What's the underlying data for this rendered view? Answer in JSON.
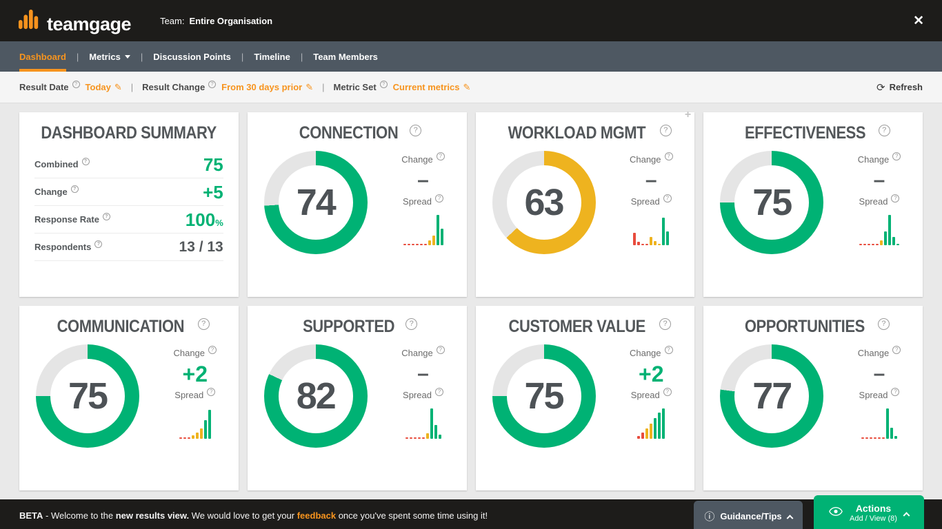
{
  "colors": {
    "orange": "#f7941e",
    "green": "#00b274",
    "yellow": "#eeb31f",
    "red": "#e84c3d",
    "gauge_track": "#e5e5e5"
  },
  "icons": {
    "question": "?",
    "edit": "✎",
    "refresh": "⟳",
    "divider": "|",
    "close": "✕",
    "info": "ⓘ",
    "move": "+"
  },
  "header": {
    "logo_text": "teamgage",
    "team_label": "Team:",
    "team_value": "Entire Organisation"
  },
  "nav": {
    "tabs": [
      {
        "label": "Dashboard",
        "active": true
      },
      {
        "label": "Metrics",
        "caret": true
      },
      {
        "label": "Discussion Points"
      },
      {
        "label": "Timeline"
      },
      {
        "label": "Team Members"
      }
    ]
  },
  "filters": {
    "result_date_label": "Result Date",
    "result_date_value": "Today",
    "result_change_label": "Result Change",
    "result_change_value": "From 30 days prior",
    "metric_set_label": "Metric Set",
    "metric_set_value": "Current metrics",
    "refresh_label": "Refresh"
  },
  "labels": {
    "change": "Change",
    "spread": "Spread"
  },
  "summary": {
    "title": "DASHBOARD SUMMARY",
    "rows": [
      {
        "label": "Combined",
        "value": "75",
        "tone": "green",
        "size": "lg"
      },
      {
        "label": "Change",
        "value": "+5",
        "tone": "green",
        "size": "lg"
      },
      {
        "label": "Response Rate",
        "value": "100",
        "suffix": "%",
        "tone": "green",
        "size": "lg"
      },
      {
        "label": "Respondents",
        "value": "13 / 13",
        "tone": "dark",
        "size": "md"
      }
    ]
  },
  "metrics": [
    {
      "title": "CONNECTION",
      "value": 74,
      "color": "green",
      "change": "–",
      "spread": [
        [
          2,
          "r"
        ],
        [
          2,
          "r"
        ],
        [
          2,
          "r"
        ],
        [
          2,
          "r"
        ],
        [
          2,
          "r"
        ],
        [
          2,
          "r"
        ],
        [
          7,
          "y"
        ],
        [
          14,
          "y"
        ],
        [
          44,
          "g"
        ],
        [
          24,
          "g"
        ]
      ]
    },
    {
      "title": "WORKLOAD MGMT",
      "value": 63,
      "color": "yellow",
      "change": "–",
      "move_handle": true,
      "spread": [
        [
          18,
          "r"
        ],
        [
          5,
          "r"
        ],
        [
          2,
          "r"
        ],
        [
          2,
          "r"
        ],
        [
          12,
          "y"
        ],
        [
          6,
          "y"
        ],
        [
          2,
          "y"
        ],
        [
          40,
          "g"
        ],
        [
          20,
          "g"
        ]
      ]
    },
    {
      "title": "EFFECTIVENESS",
      "value": 75,
      "color": "green",
      "change": "–",
      "spread": [
        [
          2,
          "r"
        ],
        [
          2,
          "r"
        ],
        [
          2,
          "r"
        ],
        [
          2,
          "r"
        ],
        [
          2,
          "r"
        ],
        [
          7,
          "y"
        ],
        [
          20,
          "g"
        ],
        [
          44,
          "g"
        ],
        [
          12,
          "g"
        ],
        [
          2,
          "g"
        ]
      ]
    },
    {
      "title": "COMMUNICATION",
      "value": 75,
      "color": "green",
      "change": "+2",
      "spread": [
        [
          2,
          "r"
        ],
        [
          2,
          "r"
        ],
        [
          2,
          "r"
        ],
        [
          5,
          "y"
        ],
        [
          9,
          "y"
        ],
        [
          15,
          "y"
        ],
        [
          27,
          "g"
        ],
        [
          42,
          "g"
        ]
      ]
    },
    {
      "title": "SUPPORTED",
      "value": 82,
      "color": "green",
      "change": "–",
      "spread": [
        [
          2,
          "r"
        ],
        [
          2,
          "r"
        ],
        [
          2,
          "r"
        ],
        [
          2,
          "r"
        ],
        [
          2,
          "r"
        ],
        [
          8,
          "y"
        ],
        [
          44,
          "g"
        ],
        [
          20,
          "g"
        ],
        [
          6,
          "g"
        ]
      ]
    },
    {
      "title": "CUSTOMER VALUE",
      "value": 75,
      "color": "green",
      "change": "+2",
      "spread": [
        [
          4,
          "r"
        ],
        [
          9,
          "r"
        ],
        [
          15,
          "y"
        ],
        [
          22,
          "y"
        ],
        [
          30,
          "g"
        ],
        [
          38,
          "g"
        ],
        [
          44,
          "g"
        ]
      ]
    },
    {
      "title": "OPPORTUNITIES",
      "value": 77,
      "color": "green",
      "change": "–",
      "spread": [
        [
          2,
          "r"
        ],
        [
          2,
          "r"
        ],
        [
          2,
          "r"
        ],
        [
          2,
          "r"
        ],
        [
          2,
          "r"
        ],
        [
          2,
          "r"
        ],
        [
          44,
          "g"
        ],
        [
          16,
          "g"
        ],
        [
          4,
          "g"
        ]
      ]
    }
  ],
  "footer": {
    "beta": "BETA",
    "text_1": " - Welcome to the ",
    "bold_1": "new results view.",
    "text_2": " We would love to get your ",
    "link_feedback": "feedback",
    "text_3": " once you've spent some time using it!",
    "guidance_label": "Guidance/Tips",
    "actions_label": "Actions",
    "actions_sub": "Add / View (8)"
  }
}
